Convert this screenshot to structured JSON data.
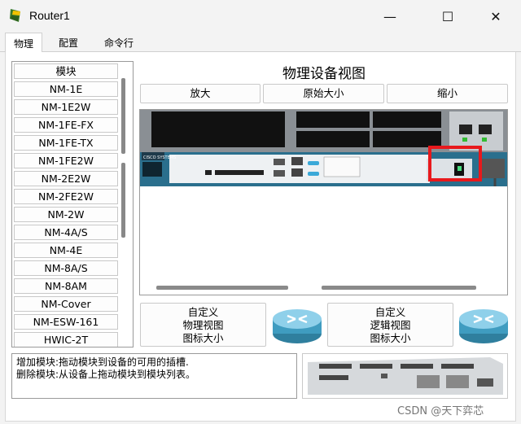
{
  "window": {
    "title": "Router1",
    "minimize": "—",
    "maximize": "☐",
    "close": "✕"
  },
  "tabs": [
    {
      "label": "物理"
    },
    {
      "label": "配置"
    },
    {
      "label": "命令行"
    }
  ],
  "modules": {
    "items": [
      "模块",
      "NM-1E",
      "NM-1E2W",
      "NM-1FE-FX",
      "NM-1FE-TX",
      "NM-1FE2W",
      "NM-2E2W",
      "NM-2FE2W",
      "NM-2W",
      "NM-4A/S",
      "NM-4E",
      "NM-8A/S",
      "NM-8AM",
      "NM-Cover",
      "NM-ESW-161",
      "HWIC-2T"
    ]
  },
  "view": {
    "heading": "物理设备视图",
    "zoom_in": "放大",
    "original_size": "原始大小",
    "zoom_out": "缩小"
  },
  "icon_size": {
    "physical_line1": "自定义",
    "physical_line2": "物理视图",
    "physical_line3": "图标大小",
    "logical_line1": "自定义",
    "logical_line2": "逻辑视图",
    "logical_line3": "图标大小"
  },
  "help": {
    "add": "增加模块:拖动模块到设备的可用的插槽.",
    "remove": "删除模块:从设备上拖动模块到模块列表。"
  },
  "device": {
    "brand": "CISCO SYSTEMS"
  },
  "watermark": "CSDN @天下弈芯",
  "colors": {
    "accent": "#1e6b8c",
    "highlight": "#e8191c",
    "power_led": "#22c55e"
  }
}
